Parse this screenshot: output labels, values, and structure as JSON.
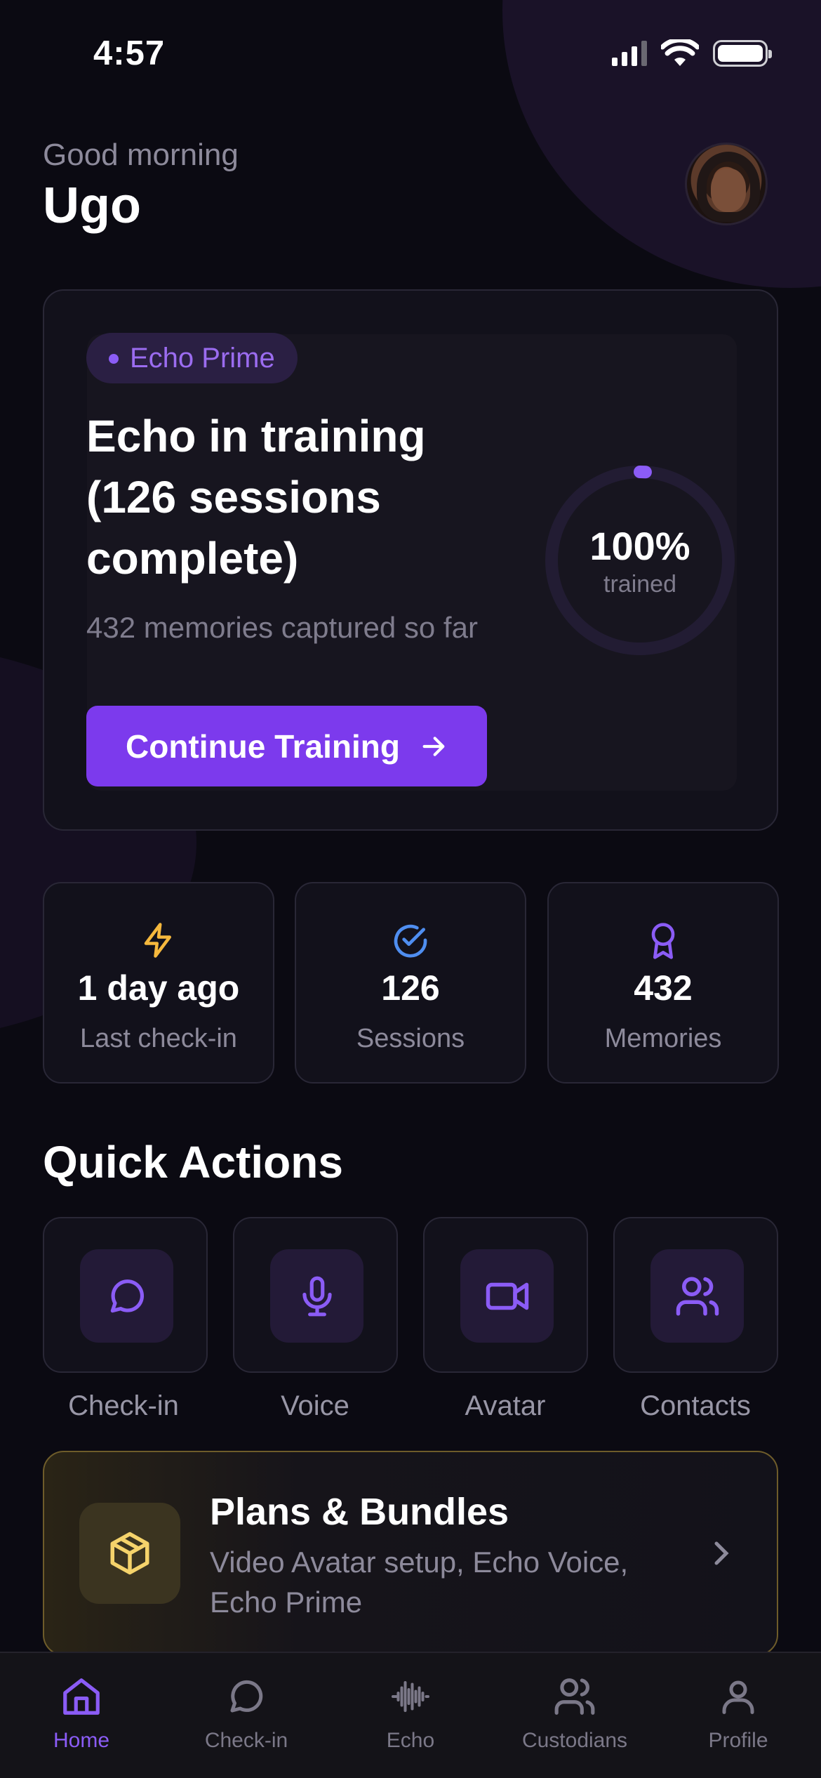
{
  "status_bar": {
    "time": "4:57"
  },
  "header": {
    "greeting": "Good morning",
    "name": "Ugo"
  },
  "hero": {
    "chip": "Echo Prime",
    "title": "Echo in training (126 sessions complete)",
    "subtitle": "432 memories captured so far",
    "cta_label": "Continue Training",
    "progress_percent": 100,
    "progress_text": "100%",
    "progress_label": "trained"
  },
  "stats": [
    {
      "value": "1 day ago",
      "label": "Last check-in",
      "icon": "lightning-icon",
      "color": "#f5b83d"
    },
    {
      "value": "126",
      "label": "Sessions",
      "icon": "check-circle-icon",
      "color": "#4f8ef0"
    },
    {
      "value": "432",
      "label": "Memories",
      "icon": "award-icon",
      "color": "#8b5cf6"
    }
  ],
  "quick_actions": {
    "title": "Quick Actions",
    "items": [
      {
        "label": "Check-in",
        "icon": "chat-bubble-icon"
      },
      {
        "label": "Voice",
        "icon": "microphone-icon"
      },
      {
        "label": "Avatar",
        "icon": "video-camera-icon"
      },
      {
        "label": "Contacts",
        "icon": "users-icon"
      }
    ]
  },
  "plans": {
    "title": "Plans & Bundles",
    "subtitle": "Video Avatar setup, Echo Voice, Echo Prime",
    "icon": "box-icon"
  },
  "tab_bar": {
    "active": "Home",
    "items": [
      {
        "label": "Home",
        "icon": "home-icon"
      },
      {
        "label": "Check-in",
        "icon": "chat-bubble-icon"
      },
      {
        "label": "Echo",
        "icon": "waveform-icon"
      },
      {
        "label": "Custodians",
        "icon": "users-icon"
      },
      {
        "label": "Profile",
        "icon": "user-icon"
      }
    ]
  },
  "colors": {
    "accent": "#7c3aed",
    "background": "#0b0a12",
    "gold": "#f5d36b"
  }
}
